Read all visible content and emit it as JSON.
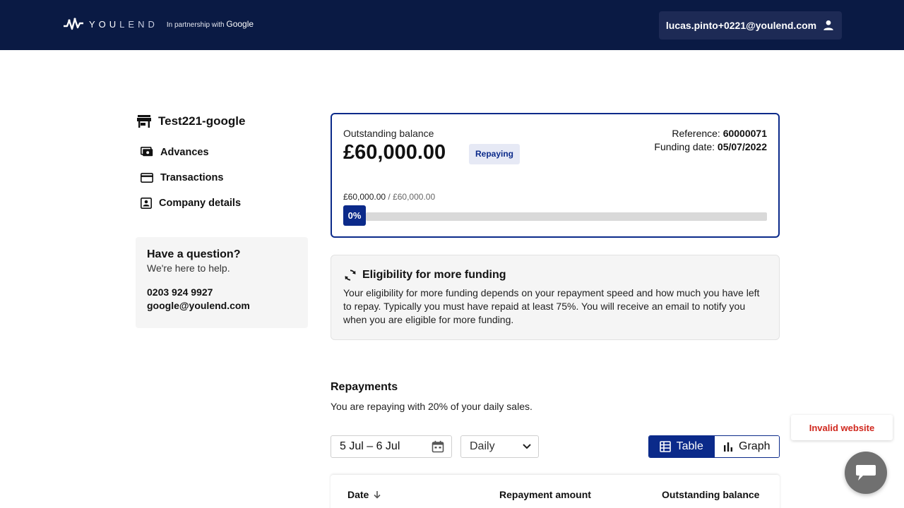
{
  "header": {
    "brand_bold": "YOU",
    "brand_light": "LEND",
    "partner_prefix": "In partnership with",
    "partner_name": "Google",
    "user_email": "lucas.pinto+0221@youlend.com"
  },
  "sidebar": {
    "company_name": "Test221-google",
    "items": [
      {
        "label": "Advances",
        "icon": "advances-icon"
      },
      {
        "label": "Transactions",
        "icon": "card-icon"
      },
      {
        "label": "Company details",
        "icon": "contact-icon"
      }
    ],
    "help": {
      "title": "Have a question?",
      "subtitle": "We're here to help.",
      "phone": "0203 924 9927",
      "email": "google@youlend.com"
    }
  },
  "balance": {
    "label": "Outstanding balance",
    "amount": "£60,000.00",
    "status": "Repaying",
    "reference_label": "Reference:",
    "reference_value": "60000071",
    "funding_date_label": "Funding date:",
    "funding_date_value": "05/07/2022",
    "progress_current": "£60,000.00",
    "progress_total": "/ £60,000.00",
    "progress_pct_label": "0%",
    "progress_fraction": 0
  },
  "eligibility": {
    "title": "Eligibility for more funding",
    "body": "Your eligibility for more funding depends on your repayment speed and how much you have left to repay. Typically you must have repaid at least 75%. You will receive an email to notify you when you are eligible for more funding."
  },
  "repayments": {
    "title": "Repayments",
    "subtitle": "You are repaying with 20% of your daily sales.",
    "date_range": "5 Jul – 6 Jul",
    "period": "Daily",
    "view_table": "Table",
    "view_graph": "Graph",
    "columns": [
      "Date",
      "Repayment amount",
      "Outstanding balance"
    ]
  },
  "toast": {
    "message": "Invalid website"
  },
  "colors": {
    "navy": "#0a1a44",
    "brand_blue": "#0b2a8a",
    "error_red": "#d0271d"
  }
}
